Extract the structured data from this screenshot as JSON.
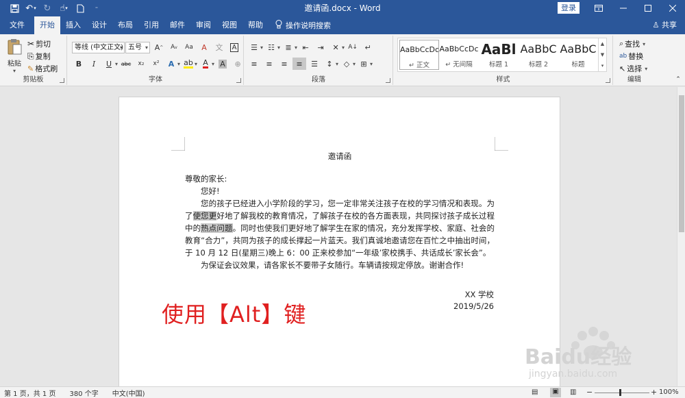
{
  "window": {
    "title": "邀请函.docx - Word",
    "login_label": "登录"
  },
  "tabs": [
    "文件",
    "开始",
    "插入",
    "设计",
    "布局",
    "引用",
    "邮件",
    "审阅",
    "视图",
    "帮助"
  ],
  "tell_me": "操作说明搜索",
  "share": "共享",
  "ribbon": {
    "clipboard": {
      "label": "剪贴板",
      "paste": "粘贴",
      "cut": "剪切",
      "copy": "复制",
      "format_painter": "格式刷"
    },
    "font": {
      "label": "字体",
      "font_name": "等线 (中文正文)",
      "font_size": "五号"
    },
    "paragraph": {
      "label": "段落"
    },
    "styles": {
      "label": "样式",
      "items": [
        {
          "sample": "AaBbCcDc",
          "name": "正文"
        },
        {
          "sample": "AaBbCcDc",
          "name": "无间隔"
        },
        {
          "sample": "AaBl",
          "name": "标题 1"
        },
        {
          "sample": "AaBbC",
          "name": "标题 2"
        },
        {
          "sample": "AaBbC",
          "name": "标题"
        }
      ]
    },
    "editing": {
      "label": "编辑",
      "find": "查找",
      "replace": "替换",
      "select": "选择"
    }
  },
  "document": {
    "title": "邀请函",
    "salutation": "尊敬的家长:",
    "greeting": "您好!",
    "p1_before": "您的孩子已经进入小学阶段的学习，您一定非常关注孩子在校的学习情况和表现。为了",
    "p1_hl1": "使您更",
    "p1_mid": "好地了解我校的教育情况，了解孩子在校的各方面表现，共同探讨孩子成长过程中的",
    "p1_hl2": "热点问题",
    "p1_after": "。同时也使我们更好地了解学生在家的情况，充分发挥学校、家庭、社会的教育“合力”，共同为孩子的成长撑起一片蓝天。我们真诚地邀请您在百忙之中抽出时间，于 10 月 12 日(星期三)晚上 6：00 正来校参加“一年级’家校携手、共话成长’家长会”。",
    "p2": "为保证会议效果，请各家长不要带子女随行。车辆请按规定停放。谢谢合作!",
    "signature": "XX 学校",
    "date": "2019/5/26"
  },
  "overlay": "使用【Alt】键",
  "watermark": {
    "brand": "Baidu经验",
    "url": "jingyan.baidu.com"
  },
  "status": {
    "page": "第 1 页，共 1 页",
    "words": "380 个字",
    "language": "中文(中国)",
    "zoom": "100%"
  },
  "colors": {
    "accent": "#2b579a",
    "overlay": "#e02020"
  }
}
